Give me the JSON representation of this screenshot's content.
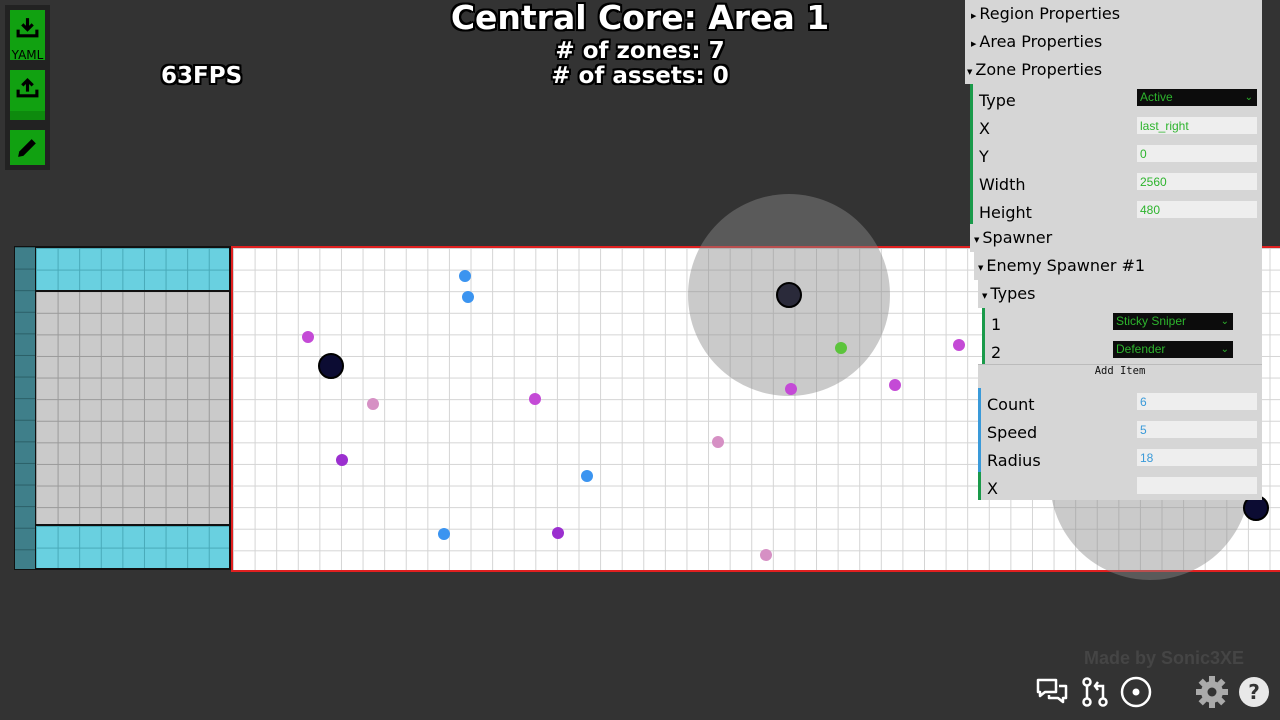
{
  "toolbar": {
    "download_label": "YAML",
    "download_icon": "download-icon",
    "upload_icon": "upload-icon",
    "edit_icon": "pencil-icon",
    "accent": "#11a111"
  },
  "hud": {
    "title": "Central Core: Area 1",
    "zones": "# of zones: 7",
    "assets": "# of assets: 0",
    "fps": "63FPS"
  },
  "panel": {
    "region_properties": "Region Properties",
    "area_properties": "Area Properties",
    "zone_properties": "Zone Properties",
    "zone": {
      "type_label": "Type",
      "type_value": "Active",
      "x_label": "X",
      "x_value": "last_right",
      "y_label": "Y",
      "y_value": "0",
      "width_label": "Width",
      "width_value": "2560",
      "height_label": "Height",
      "height_value": "480"
    },
    "spawner": "Spawner",
    "enemy_spawner": "Enemy Spawner #1",
    "types_label": "Types",
    "types": [
      {
        "index": "1",
        "value": "Sticky Sniper"
      },
      {
        "index": "2",
        "value": "Defender"
      }
    ],
    "add_item": "Add Item",
    "count_label": "Count",
    "count_value": "6",
    "speed_label": "Speed",
    "speed_value": "5",
    "radius_label": "Radius",
    "radius_value": "18",
    "x2_label": "X",
    "x2_value": ""
  },
  "footer": {
    "credit": "Made by Sonic3XE",
    "icons": [
      "chat-icon",
      "git-pull-request-icon",
      "record-icon",
      "gear-icon",
      "help-icon"
    ]
  },
  "colors": {
    "background": "#333333",
    "safe_zone": "#cacaca",
    "exit_zone": "#69d0e0",
    "active_border": "#e02020",
    "input_text": "#2db42d"
  }
}
